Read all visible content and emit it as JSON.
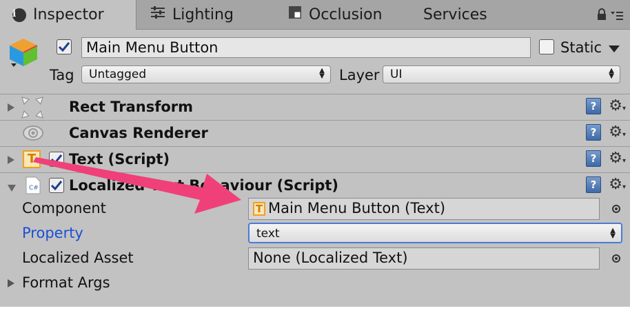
{
  "tabs": [
    {
      "label": "Inspector",
      "icon": "info-icon"
    },
    {
      "label": "Lighting",
      "icon": "sliders-icon"
    },
    {
      "label": "Occlusion",
      "icon": "occlusion-icon"
    },
    {
      "label": "Services",
      "icon": ""
    }
  ],
  "object": {
    "name": "Main Menu Button",
    "active": true,
    "static_label": "Static",
    "static_checked": false,
    "tag_label": "Tag",
    "tag_value": "Untagged",
    "layer_label": "Layer",
    "layer_value": "UI"
  },
  "components": [
    {
      "title": "Rect Transform",
      "icon": "rect-transform-icon",
      "expanded": false,
      "has_checkbox": false
    },
    {
      "title": "Canvas Renderer",
      "icon": "eye-icon",
      "expanded": false,
      "has_checkbox": false
    },
    {
      "title": "Text (Script)",
      "icon": "text-component-icon",
      "expanded": false,
      "has_checkbox": true,
      "enabled": true
    },
    {
      "title": "Localized Text Behaviour (Script)",
      "icon": "csharp-script-icon",
      "expanded": true,
      "has_checkbox": true,
      "enabled": true
    }
  ],
  "fields": {
    "component_label": "Component",
    "component_value": "Main Menu Button (Text)",
    "property_label": "Property",
    "property_value": "text",
    "asset_label": "Localized Asset",
    "asset_value": "None (Localized Text)",
    "format_args_label": "Format Args"
  },
  "colors": {
    "panel_bg": "#c2c2c2",
    "tab_bar_bg": "#a5a5a5",
    "property_label": "#1a4fd6",
    "focus_border": "#4a7ad8",
    "annotation_arrow": "#f0407a",
    "checkbox_tick": "#1f3f8a"
  }
}
